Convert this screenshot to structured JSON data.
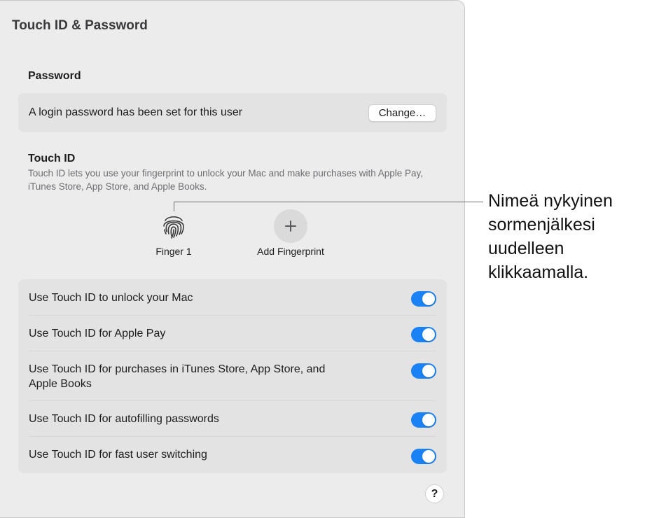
{
  "window": {
    "title": "Touch ID & Password"
  },
  "password": {
    "section_title": "Password",
    "status_text": "A login password has been set for this user",
    "change_button": "Change…"
  },
  "touch_id": {
    "section_title": "Touch ID",
    "description": "Touch ID lets you use your fingerprint to unlock your Mac and make purchases with Apple Pay, iTunes Store, App Store, and Apple Books.",
    "fingerprints": [
      {
        "label": "Finger 1",
        "icon": "fingerprint-icon"
      }
    ],
    "add_fingerprint_label": "Add Fingerprint",
    "add_icon": "plus-icon"
  },
  "options": [
    {
      "label": "Use Touch ID to unlock your Mac",
      "enabled": true
    },
    {
      "label": "Use Touch ID for Apple Pay",
      "enabled": true
    },
    {
      "label": "Use Touch ID for purchases in iTunes Store, App Store, and Apple Books",
      "enabled": true
    },
    {
      "label": "Use Touch ID for autofilling passwords",
      "enabled": true
    },
    {
      "label": "Use Touch ID for fast user switching",
      "enabled": true
    }
  ],
  "help_button": "?",
  "callout": {
    "text": "Nimeä nykyinen sormenjälkesi uudelleen klikkaamalla."
  },
  "colors": {
    "toggle_on": "#1a82f5",
    "window_bg": "#ececec",
    "group_bg": "#e3e3e3"
  }
}
